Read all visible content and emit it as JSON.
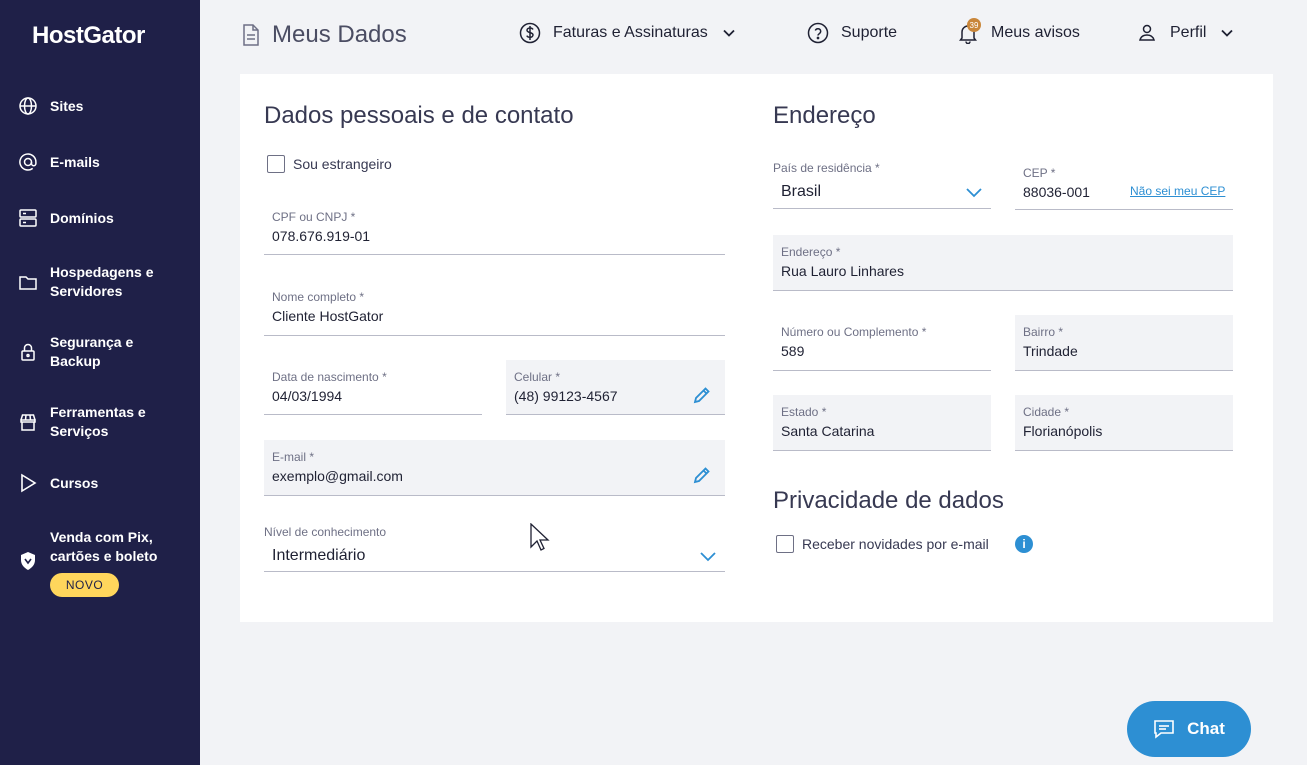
{
  "brand": {
    "logo": "HostGator"
  },
  "sidebar": {
    "items": [
      {
        "label": "Sites",
        "icon": "globe-icon"
      },
      {
        "label": "E-mails",
        "icon": "at-icon"
      },
      {
        "label": "Domínios",
        "icon": "server-icon"
      },
      {
        "label": "Hospedagens e Servidores",
        "icon": "folder-icon"
      },
      {
        "label": "Segurança e Backup",
        "icon": "lock-icon"
      },
      {
        "label": "Ferramentas e Serviços",
        "icon": "store-icon"
      },
      {
        "label": "Cursos",
        "icon": "play-icon"
      },
      {
        "label": "Venda com Pix, cartões e boleto",
        "icon": "shield-icon",
        "badge": "NOVO"
      }
    ]
  },
  "header": {
    "title": "Meus Dados",
    "billing": "Faturas e Assinaturas",
    "support": "Suporte",
    "notices": "Meus avisos",
    "notices_count": "39",
    "profile": "Perfil"
  },
  "personal": {
    "title": "Dados pessoais e de contato",
    "foreigner_label": "Sou estrangeiro",
    "cpf": {
      "label": "CPF ou CNPJ *",
      "value": "078.676.919-01"
    },
    "name": {
      "label": "Nome completo *",
      "value": "Cliente HostGator"
    },
    "birth": {
      "label": "Data de nascimento *",
      "value": "04/03/1994"
    },
    "phone": {
      "label": "Celular *",
      "value": "(48) 99123-4567"
    },
    "email": {
      "label": "E-mail *",
      "value": "exemplo@gmail.com"
    },
    "knowledge": {
      "label": "Nível de conhecimento",
      "value": "Intermediário"
    }
  },
  "address": {
    "title": "Endereço",
    "country": {
      "label": "País de residência *",
      "value": "Brasil"
    },
    "cep": {
      "label": "CEP *",
      "value": "88036-001",
      "link": "Não sei meu CEP"
    },
    "street": {
      "label": "Endereço *",
      "value": "Rua Lauro Linhares"
    },
    "number": {
      "label": "Número ou Complemento *",
      "value": "589"
    },
    "district": {
      "label": "Bairro *",
      "value": "Trindade"
    },
    "state": {
      "label": "Estado *",
      "value": "Santa Catarina"
    },
    "city": {
      "label": "Cidade *",
      "value": "Florianópolis"
    }
  },
  "privacy": {
    "title": "Privacidade de dados",
    "newsletter_label": "Receber novidades por e-mail"
  },
  "chat": {
    "label": "Chat"
  },
  "colors": {
    "sidebar": "#1f2048",
    "accent": "#2d8fd3",
    "badge": "#ffd65c"
  }
}
